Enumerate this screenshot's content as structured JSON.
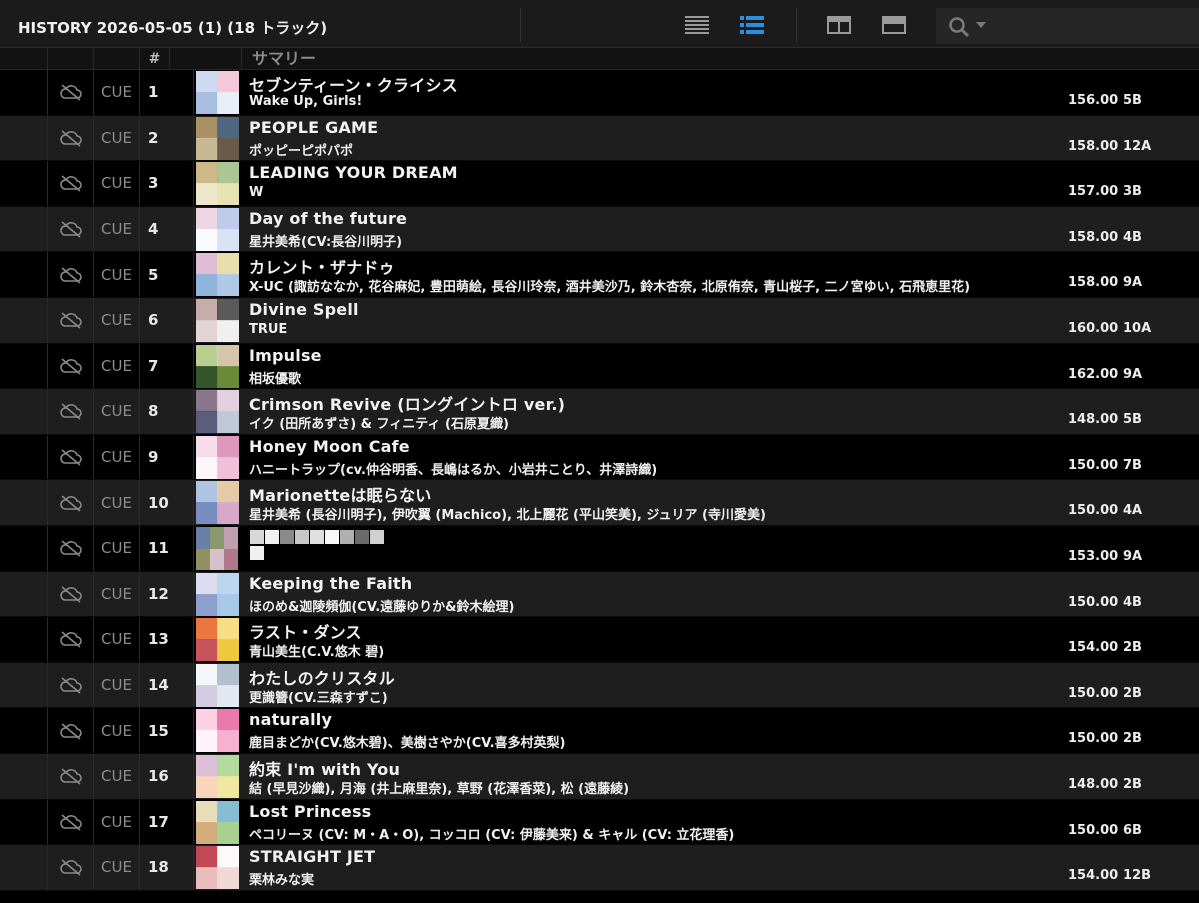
{
  "history": {
    "title": "HISTORY 2026-05-05 (1) (18 トラック)"
  },
  "toolbar": {
    "view_list_icon": "list-view-icon",
    "view_detail_icon": "detail-list-icon",
    "layout1_icon": "layout-split-icon",
    "layout2_icon": "layout-top-icon",
    "search_icon": "search-icon"
  },
  "columns": {
    "number": "#",
    "summary": "サマリー"
  },
  "cue_label": "CUE",
  "tracks": [
    {
      "num": "1",
      "title": "セブンティーン・クライシス",
      "artist": "Wake Up, Girls!",
      "bpm": "156.00",
      "key": "5B"
    },
    {
      "num": "2",
      "title": "PEOPLE GAME",
      "artist": "ポッピーピポパポ",
      "bpm": "158.00",
      "key": "12A"
    },
    {
      "num": "3",
      "title": "LEADING YOUR DREAM",
      "artist": "W",
      "bpm": "157.00",
      "key": "3B"
    },
    {
      "num": "4",
      "title": "Day of the future",
      "artist": "星井美希(CV:長谷川明子)",
      "bpm": "158.00",
      "key": "4B"
    },
    {
      "num": "5",
      "title": "カレント・ザナドゥ",
      "artist": "X-UC (諏訪ななか, 花谷麻妃, 豊田萌絵, 長谷川玲奈, 酒井美沙乃, 鈴木杏奈, 北原侑奈, 青山桜子, 二ノ宮ゆい, 石飛恵里花)",
      "bpm": "158.00",
      "key": "9A"
    },
    {
      "num": "6",
      "title": "Divine Spell",
      "artist": "TRUE",
      "bpm": "160.00",
      "key": "10A"
    },
    {
      "num": "7",
      "title": "Impulse",
      "artist": "相坂優歌",
      "bpm": "162.00",
      "key": "9A"
    },
    {
      "num": "8",
      "title": "Crimson Revive (ロングイントロ ver.)",
      "artist": "イク (田所あずさ) & フィニティ (石原夏織)",
      "bpm": "148.00",
      "key": "5B"
    },
    {
      "num": "9",
      "title": "Honey Moon Cafe",
      "artist": "ハニートラップ(cv.仲谷明香、長嶋はるか、小岩井ことり、井澤詩織)",
      "bpm": "150.00",
      "key": "7B"
    },
    {
      "num": "10",
      "title": "Marionetteは眠らない",
      "artist": "星井美希 (長谷川明子), 伊吹翼 (Machico), 北上麗花 (平山笑美), ジュリア (寺川愛美)",
      "bpm": "150.00",
      "key": "4A"
    },
    {
      "num": "11",
      "title": "",
      "artist": "",
      "bpm": "153.00",
      "key": "9A"
    },
    {
      "num": "12",
      "title": "Keeping the Faith",
      "artist": "ほのめ&迦陵頻伽(CV.遠藤ゆりか&鈴木絵理)",
      "bpm": "150.00",
      "key": "4B"
    },
    {
      "num": "13",
      "title": "ラスト・ダンス",
      "artist": "青山美生(C.V.悠木 碧)",
      "bpm": "154.00",
      "key": "2B"
    },
    {
      "num": "14",
      "title": "わたしのクリスタル",
      "artist": "更識簪(CV.三森すずこ)",
      "bpm": "150.00",
      "key": "2B"
    },
    {
      "num": "15",
      "title": "naturally",
      "artist": "鹿目まどか(CV.悠木碧)、美樹さやか(CV.喜多村英梨)",
      "bpm": "150.00",
      "key": "2B"
    },
    {
      "num": "16",
      "title": "約束 I'm with You",
      "artist": "結 (早見沙織), 月海 (井上麻里奈), 草野 (花澤香菜), 松 (遠藤綾)",
      "bpm": "148.00",
      "key": "2B"
    },
    {
      "num": "17",
      "title": "Lost Princess",
      "artist": "ペコリーヌ (CV: M・A・O), コッコロ (CV: 伊藤美来) & キャル (CV: 立花理香)",
      "bpm": "150.00",
      "key": "6B"
    },
    {
      "num": "18",
      "title": "STRAIGHT JET",
      "artist": "栗林みな実",
      "bpm": "154.00",
      "key": "12B"
    }
  ],
  "colors": {
    "accent": "#2a8fe0",
    "row_alt": "#1e1e1e",
    "background": "#000000"
  }
}
